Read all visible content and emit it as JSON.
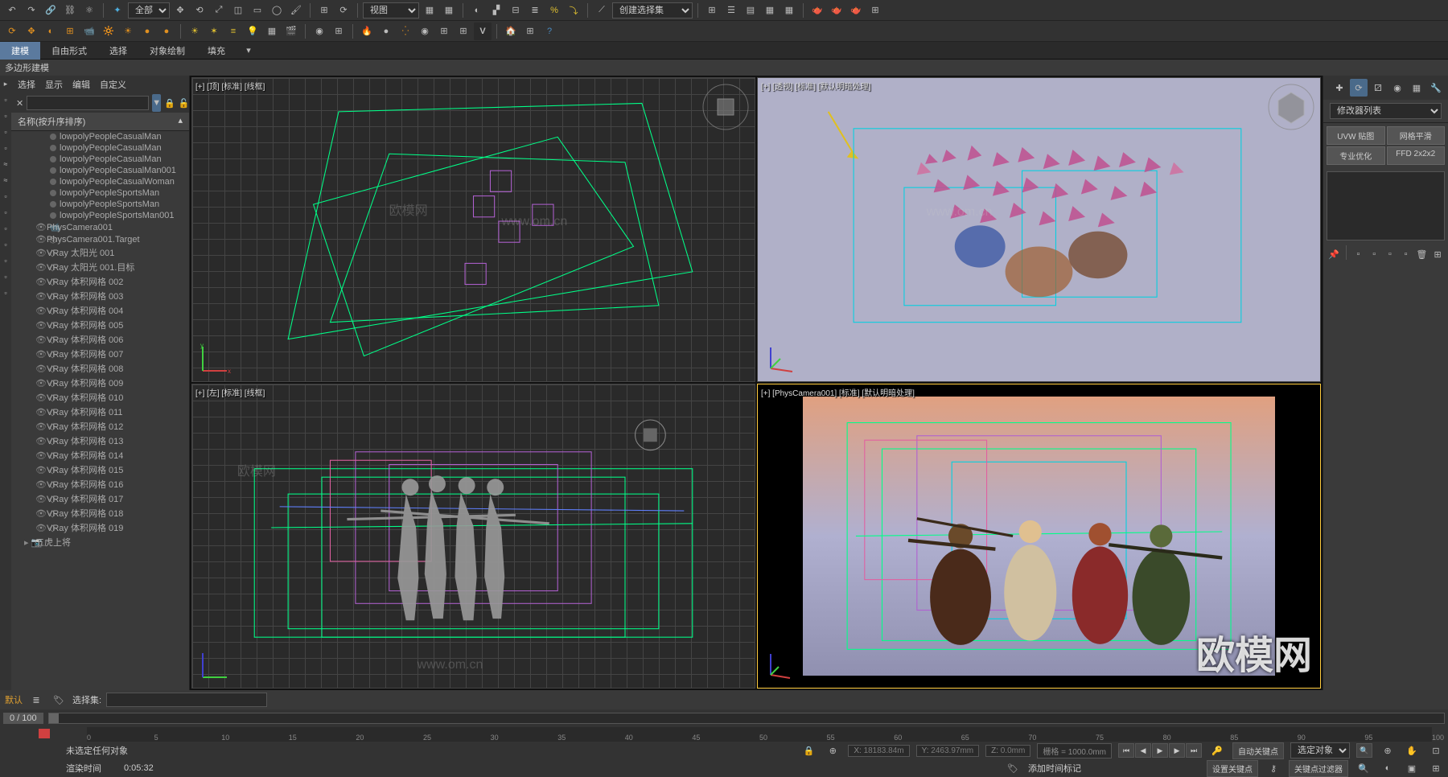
{
  "toolbar1": {
    "undo": "↶",
    "redo": "↷",
    "link": "⛓",
    "dropdown1": "全部",
    "view_label": "视图",
    "create_set": "创建选择集"
  },
  "toolbar2": {
    "items": [
      "⟳",
      "⊕",
      "◐",
      "⊞",
      "📹",
      "🔆",
      "☀",
      "●",
      "●",
      "🔆",
      "☀",
      "✶",
      "≡",
      "💡",
      "▦",
      "🎬",
      "◉",
      "⊞",
      "◐",
      "●",
      "●●",
      "◉",
      "⊞",
      "⊞",
      "V",
      "🏠",
      "⊞",
      "?"
    ]
  },
  "tabs": {
    "items": [
      "建模",
      "自由形式",
      "选择",
      "对象绘制",
      "填充"
    ],
    "active": 0,
    "sub": "多边形建模"
  },
  "left_panel": {
    "header_items": [
      "选择",
      "显示",
      "编辑",
      "自定义"
    ],
    "filter_placeholder": "",
    "scene_title": "名称(按升序排序)",
    "items": [
      {
        "name": "lowpolyPeopleCasualMan",
        "indent": 2,
        "dot": true
      },
      {
        "name": "lowpolyPeopleCasualMan",
        "indent": 2,
        "dot": true
      },
      {
        "name": "lowpolyPeopleCasualMan",
        "indent": 2,
        "dot": true
      },
      {
        "name": "lowpolyPeopleCasualMan001",
        "indent": 2,
        "dot": true
      },
      {
        "name": "lowpolyPeopleCasualWoman",
        "indent": 2,
        "dot": true
      },
      {
        "name": "lowpolyPeopleSportsMan",
        "indent": 2,
        "dot": true
      },
      {
        "name": "lowpolyPeopleSportsMan",
        "indent": 2,
        "dot": true
      },
      {
        "name": "lowpolyPeopleSportsMan001",
        "indent": 2,
        "dot": true
      },
      {
        "name": "PhysCamera001",
        "indent": 1,
        "icon": "cam"
      },
      {
        "name": "PhysCamera001.Target",
        "indent": 1,
        "icon": "target"
      },
      {
        "name": "VRay 太阳光 001",
        "indent": 1,
        "icon": "vis"
      },
      {
        "name": "VRay 太阳光 001.目标",
        "indent": 1,
        "icon": "vis"
      },
      {
        "name": "VRay 体积网格 002",
        "indent": 1,
        "icon": "vis"
      },
      {
        "name": "VRay 体积网格 003",
        "indent": 1,
        "icon": "vis"
      },
      {
        "name": "VRay 体积网格 004",
        "indent": 1,
        "icon": "vis"
      },
      {
        "name": "VRay 体积网格 005",
        "indent": 1,
        "icon": "vis"
      },
      {
        "name": "VRay 体积网格 006",
        "indent": 1,
        "icon": "vis"
      },
      {
        "name": "VRay 体积网格 007",
        "indent": 1,
        "icon": "vis"
      },
      {
        "name": "VRay 体积网格 008",
        "indent": 1,
        "icon": "vis"
      },
      {
        "name": "VRay 体积网格 009",
        "indent": 1,
        "icon": "vis"
      },
      {
        "name": "VRay 体积网格 010",
        "indent": 1,
        "icon": "vis"
      },
      {
        "name": "VRay 体积网格 011",
        "indent": 1,
        "icon": "vis"
      },
      {
        "name": "VRay 体积网格 012",
        "indent": 1,
        "icon": "vis"
      },
      {
        "name": "VRay 体积网格 013",
        "indent": 1,
        "icon": "vis"
      },
      {
        "name": "VRay 体积网格 014",
        "indent": 1,
        "icon": "vis"
      },
      {
        "name": "VRay 体积网格 015",
        "indent": 1,
        "icon": "vis"
      },
      {
        "name": "VRay 体积网格 016",
        "indent": 1,
        "icon": "vis"
      },
      {
        "name": "VRay 体积网格 017",
        "indent": 1,
        "icon": "vis"
      },
      {
        "name": "VRay 体积网格 018",
        "indent": 1,
        "icon": "vis"
      },
      {
        "name": "VRay 体积网格 019",
        "indent": 1,
        "icon": "vis"
      },
      {
        "name": "五虎上将",
        "indent": 0,
        "expand": true
      }
    ]
  },
  "viewports": {
    "top": "[+] [顶] [标准] [线框]",
    "persp": "[+] [透视] [标准] [默认明暗处理]",
    "left": "[+] [左] [标准] [线框]",
    "camera": "[+] [PhysCamera001] [标准] [默认明暗处理]"
  },
  "right_panel": {
    "title": "修改器列表",
    "buttons": [
      "UVW 贴图",
      "网格平滑",
      "专业优化",
      "FFD 2x2x2"
    ]
  },
  "selection_bar": {
    "label": "选择集:",
    "default_text": "默认"
  },
  "timeline": {
    "frame": "0 / 100",
    "ticks": [
      0,
      5,
      10,
      15,
      20,
      25,
      30,
      35,
      40,
      45,
      50,
      55,
      60,
      65,
      70,
      75,
      80,
      85,
      90,
      95,
      100
    ]
  },
  "status": {
    "no_selection": "未选定任何对象",
    "render_time_label": "渲染时间",
    "render_time": "0:05:32",
    "x": "18183.84m",
    "y": "2463.97mm",
    "z": "0.0mm",
    "grid": "栅格 = 1000.0mm",
    "add_time_tag": "添加时间标记",
    "auto_key": "自动关键点",
    "selected_objs": "选定对象",
    "set_key": "设置关键点",
    "key_filter": "关键点过滤器"
  },
  "watermark": {
    "main": "欧模网",
    "small": "欧模网",
    "url": "www.om.cn"
  }
}
